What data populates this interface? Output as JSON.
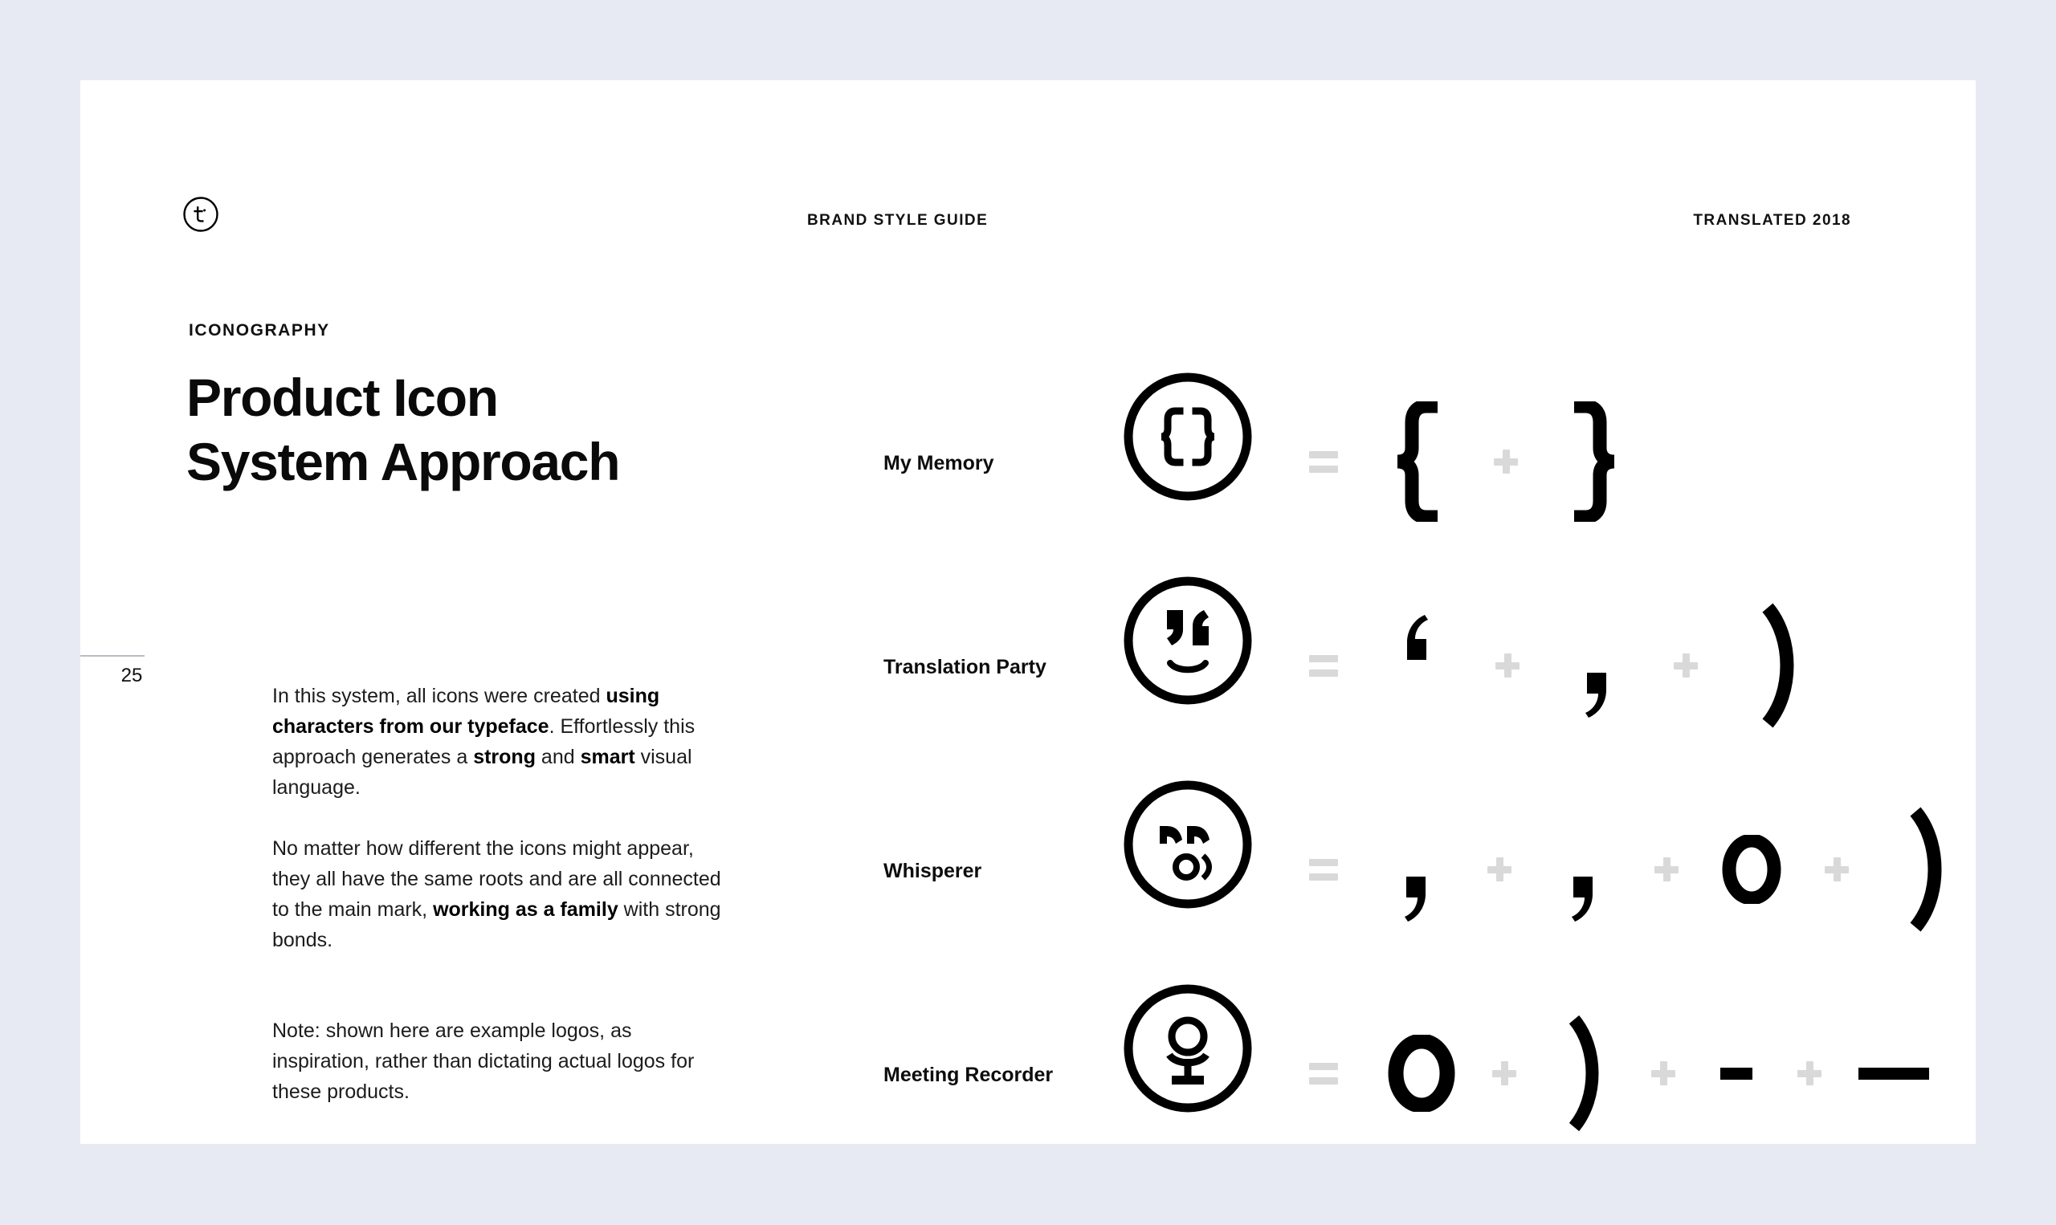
{
  "background_color": "#e7eaf2",
  "page_color": "#ffffff",
  "ink_color": "#000000",
  "operator_color": "#d9d9d9",
  "header": {
    "logo_letter": "t",
    "center_label": "BRAND STYLE GUIDE",
    "right_label": "TRANSLATED 2018"
  },
  "left": {
    "eyebrow": "ICONOGRAPHY",
    "title_line1": "Product Icon",
    "title_line2": "System Approach",
    "page_number": "25",
    "paragraph1": {
      "part1": "In this system, all icons were created ",
      "bold1": "using characters from our typeface",
      "part2": ". Effortlessly this approach generates a ",
      "bold2": "strong",
      "part3": " and ",
      "bold3": "smart",
      "part4": " visual language."
    },
    "paragraph2": {
      "part1": "No matter how different the icons might appear, they all have the same roots and are all connected to the main mark, ",
      "bold1": "working as a family",
      "part2": " with strong bonds."
    },
    "paragraph3": "Note: shown here are example logos, as inspiration, rather than dictating actual logos for these products."
  },
  "rows": [
    {
      "label": "My Memory",
      "mark": "circle-braces-icon",
      "equals": "=",
      "components": [
        {
          "glyph": "{",
          "name": "left-brace-glyph"
        },
        {
          "op": "+",
          "name": "plus-operator"
        },
        {
          "glyph": "}",
          "name": "right-brace-glyph"
        }
      ]
    },
    {
      "label": "Translation Party",
      "mark": "circle-smiley-quotes-icon",
      "equals": "=",
      "components": [
        {
          "glyph": "‘",
          "name": "left-quote-glyph"
        },
        {
          "op": "+",
          "name": "plus-operator"
        },
        {
          "glyph": "‚",
          "name": "comma-glyph"
        },
        {
          "op": "+",
          "name": "plus-operator"
        },
        {
          "glyph": ")",
          "name": "right-paren-glyph"
        }
      ]
    },
    {
      "label": "Whisperer",
      "mark": "circle-whisper-face-icon",
      "equals": "=",
      "components": [
        {
          "glyph": "‚",
          "name": "comma-glyph"
        },
        {
          "op": "+",
          "name": "plus-operator"
        },
        {
          "glyph": "‚",
          "name": "comma-glyph"
        },
        {
          "op": "+",
          "name": "plus-operator"
        },
        {
          "glyph": "o",
          "name": "lowercase-o-glyph"
        },
        {
          "op": "+",
          "name": "plus-operator"
        },
        {
          "glyph": ")",
          "name": "right-paren-glyph"
        }
      ]
    },
    {
      "label": "Meeting Recorder",
      "mark": "circle-microphone-icon",
      "equals": "=",
      "components": [
        {
          "glyph": "o",
          "name": "lowercase-o-glyph"
        },
        {
          "op": "+",
          "name": "plus-operator"
        },
        {
          "glyph": ")",
          "name": "right-paren-glyph"
        },
        {
          "op": "+",
          "name": "plus-operator"
        },
        {
          "glyph": "-",
          "name": "hyphen-glyph"
        },
        {
          "op": "+",
          "name": "plus-operator"
        },
        {
          "glyph": "—",
          "name": "em-dash-glyph"
        }
      ]
    }
  ]
}
